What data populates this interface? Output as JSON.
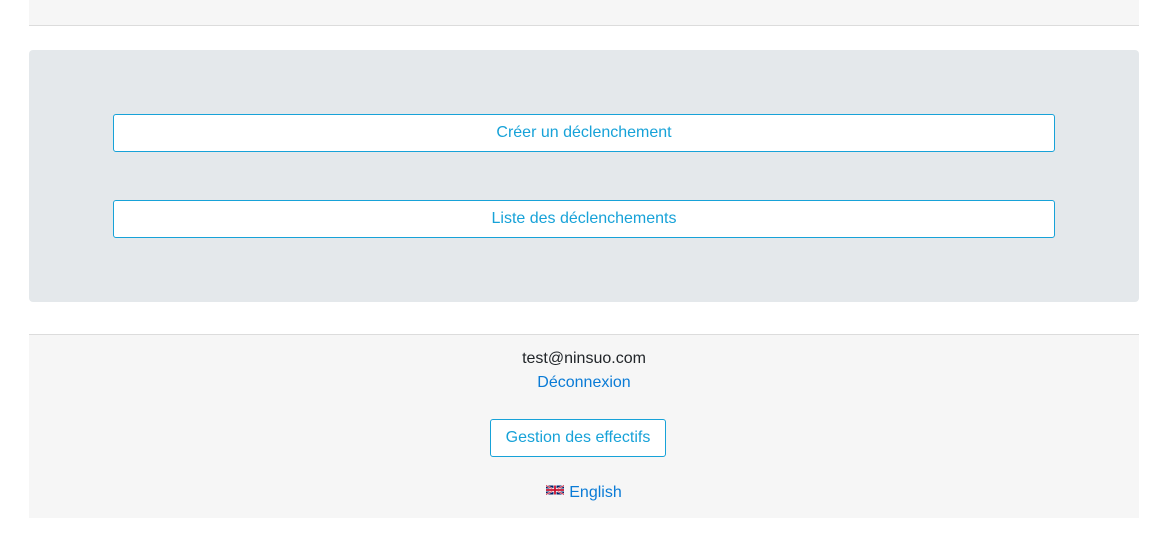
{
  "actions": {
    "create_label": "Créer un déclenchement",
    "list_label": "Liste des déclenchements"
  },
  "footer": {
    "email": "test@ninsuo.com",
    "logout_label": "Déconnexion",
    "staff_label": "Gestion des effectifs",
    "language_label": "English",
    "language_icon": "uk-flag-icon"
  },
  "colors": {
    "accent": "#17a2d8",
    "link": "#0a7bd6",
    "panel": "#e4e8eb",
    "footer_bg": "#f6f6f6"
  }
}
